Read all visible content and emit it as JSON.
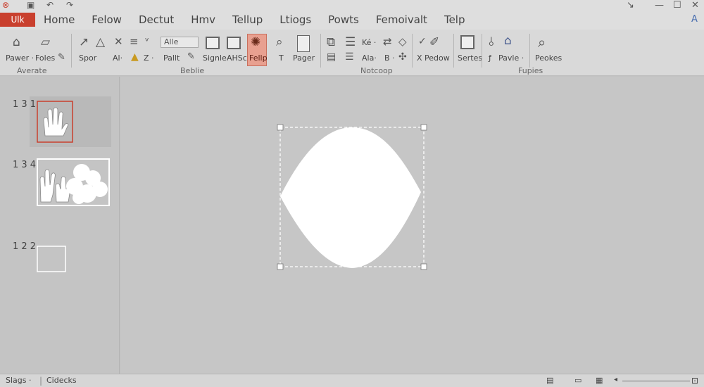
{
  "quick_access": {
    "icons": [
      "app-logo-icon",
      "save-icon",
      "redo-icon"
    ]
  },
  "tabs": {
    "file": "Ulk",
    "items": [
      "Home",
      "Felow",
      "Dectut",
      "Hmv",
      "Tellup",
      "Ltiogs",
      "Powts",
      "Femoivalt",
      "Telp"
    ]
  },
  "window_controls": {
    "ribbon_toggle": "↘",
    "minimize": "—",
    "maximize": "☐",
    "close": "✕",
    "tell_me": "A"
  },
  "ribbon": {
    "labels": {
      "pawer": "Pawer ·",
      "foles": "Foles",
      "spor": "Spor",
      "ai": "Al·",
      "z": "Z ·",
      "pallt": "Pallt",
      "signle": "Signle",
      "ahsc": "AHSc",
      "fellp": "Fellp",
      "t": "T",
      "pager": "Pager",
      "ke": "Ké ·",
      "dial": "Ala·",
      "b": "B ·",
      "x_pedow": "X Pedow",
      "sertes": "Sertes",
      "f_pavle": "Pavle ·",
      "peokes": "Peokes"
    },
    "combo_value": "Alle",
    "groups": [
      "Averate",
      "Beblie",
      "Notcoop",
      "Fupies"
    ]
  },
  "slides_pane": {
    "thumbnails": [
      {
        "number": "1 3  1",
        "selected": true
      },
      {
        "number": "1 3  4",
        "selected": false
      },
      {
        "number": "1 2  2",
        "selected": false
      }
    ]
  },
  "status_bar": {
    "slides": "Slags ·",
    "notes": "Cidecks"
  },
  "colors": {
    "file_tab": "#c9402e",
    "highlight": "#e8a090",
    "selection_border": "#c9402e"
  }
}
